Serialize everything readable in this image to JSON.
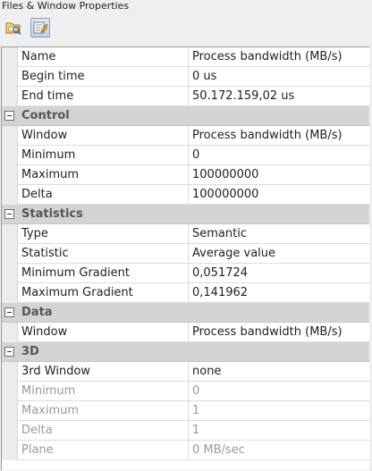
{
  "window": {
    "title": "Files & Window Properties"
  },
  "toolbar": {
    "buttons": [
      {
        "icon": "files-icon"
      },
      {
        "icon": "properties-edit-icon",
        "active": true
      }
    ]
  },
  "properties": {
    "general": [
      {
        "label": "Name",
        "value": "Process bandwidth (MB/s)"
      },
      {
        "label": "Begin time",
        "value": "0 us"
      },
      {
        "label": "End time",
        "value": "50.172.159,02 us"
      }
    ],
    "control": {
      "title": "Control",
      "rows": [
        {
          "label": "Window",
          "value": "Process bandwidth (MB/s)"
        },
        {
          "label": "Minimum",
          "value": "0"
        },
        {
          "label": "Maximum",
          "value": "100000000"
        },
        {
          "label": "Delta",
          "value": "100000000"
        }
      ]
    },
    "statistics": {
      "title": "Statistics",
      "rows": [
        {
          "label": "Type",
          "value": "Semantic"
        },
        {
          "label": "Statistic",
          "value": "Average value"
        },
        {
          "label": "Minimum Gradient",
          "value": "0,051724"
        },
        {
          "label": "Maximum Gradient",
          "value": "0,141962"
        }
      ]
    },
    "data": {
      "title": "Data",
      "rows": [
        {
          "label": "Window",
          "value": "Process bandwidth (MB/s)"
        }
      ]
    },
    "three_d": {
      "title": "3D",
      "rows": [
        {
          "label": "3rd Window",
          "value": "none"
        },
        {
          "label": "Minimum",
          "value": "0",
          "disabled": true
        },
        {
          "label": "Maximum",
          "value": "1",
          "disabled": true
        },
        {
          "label": "Delta",
          "value": "1",
          "disabled": true
        },
        {
          "label": "Plane",
          "value": "0 MB/sec",
          "disabled": true
        }
      ]
    }
  }
}
